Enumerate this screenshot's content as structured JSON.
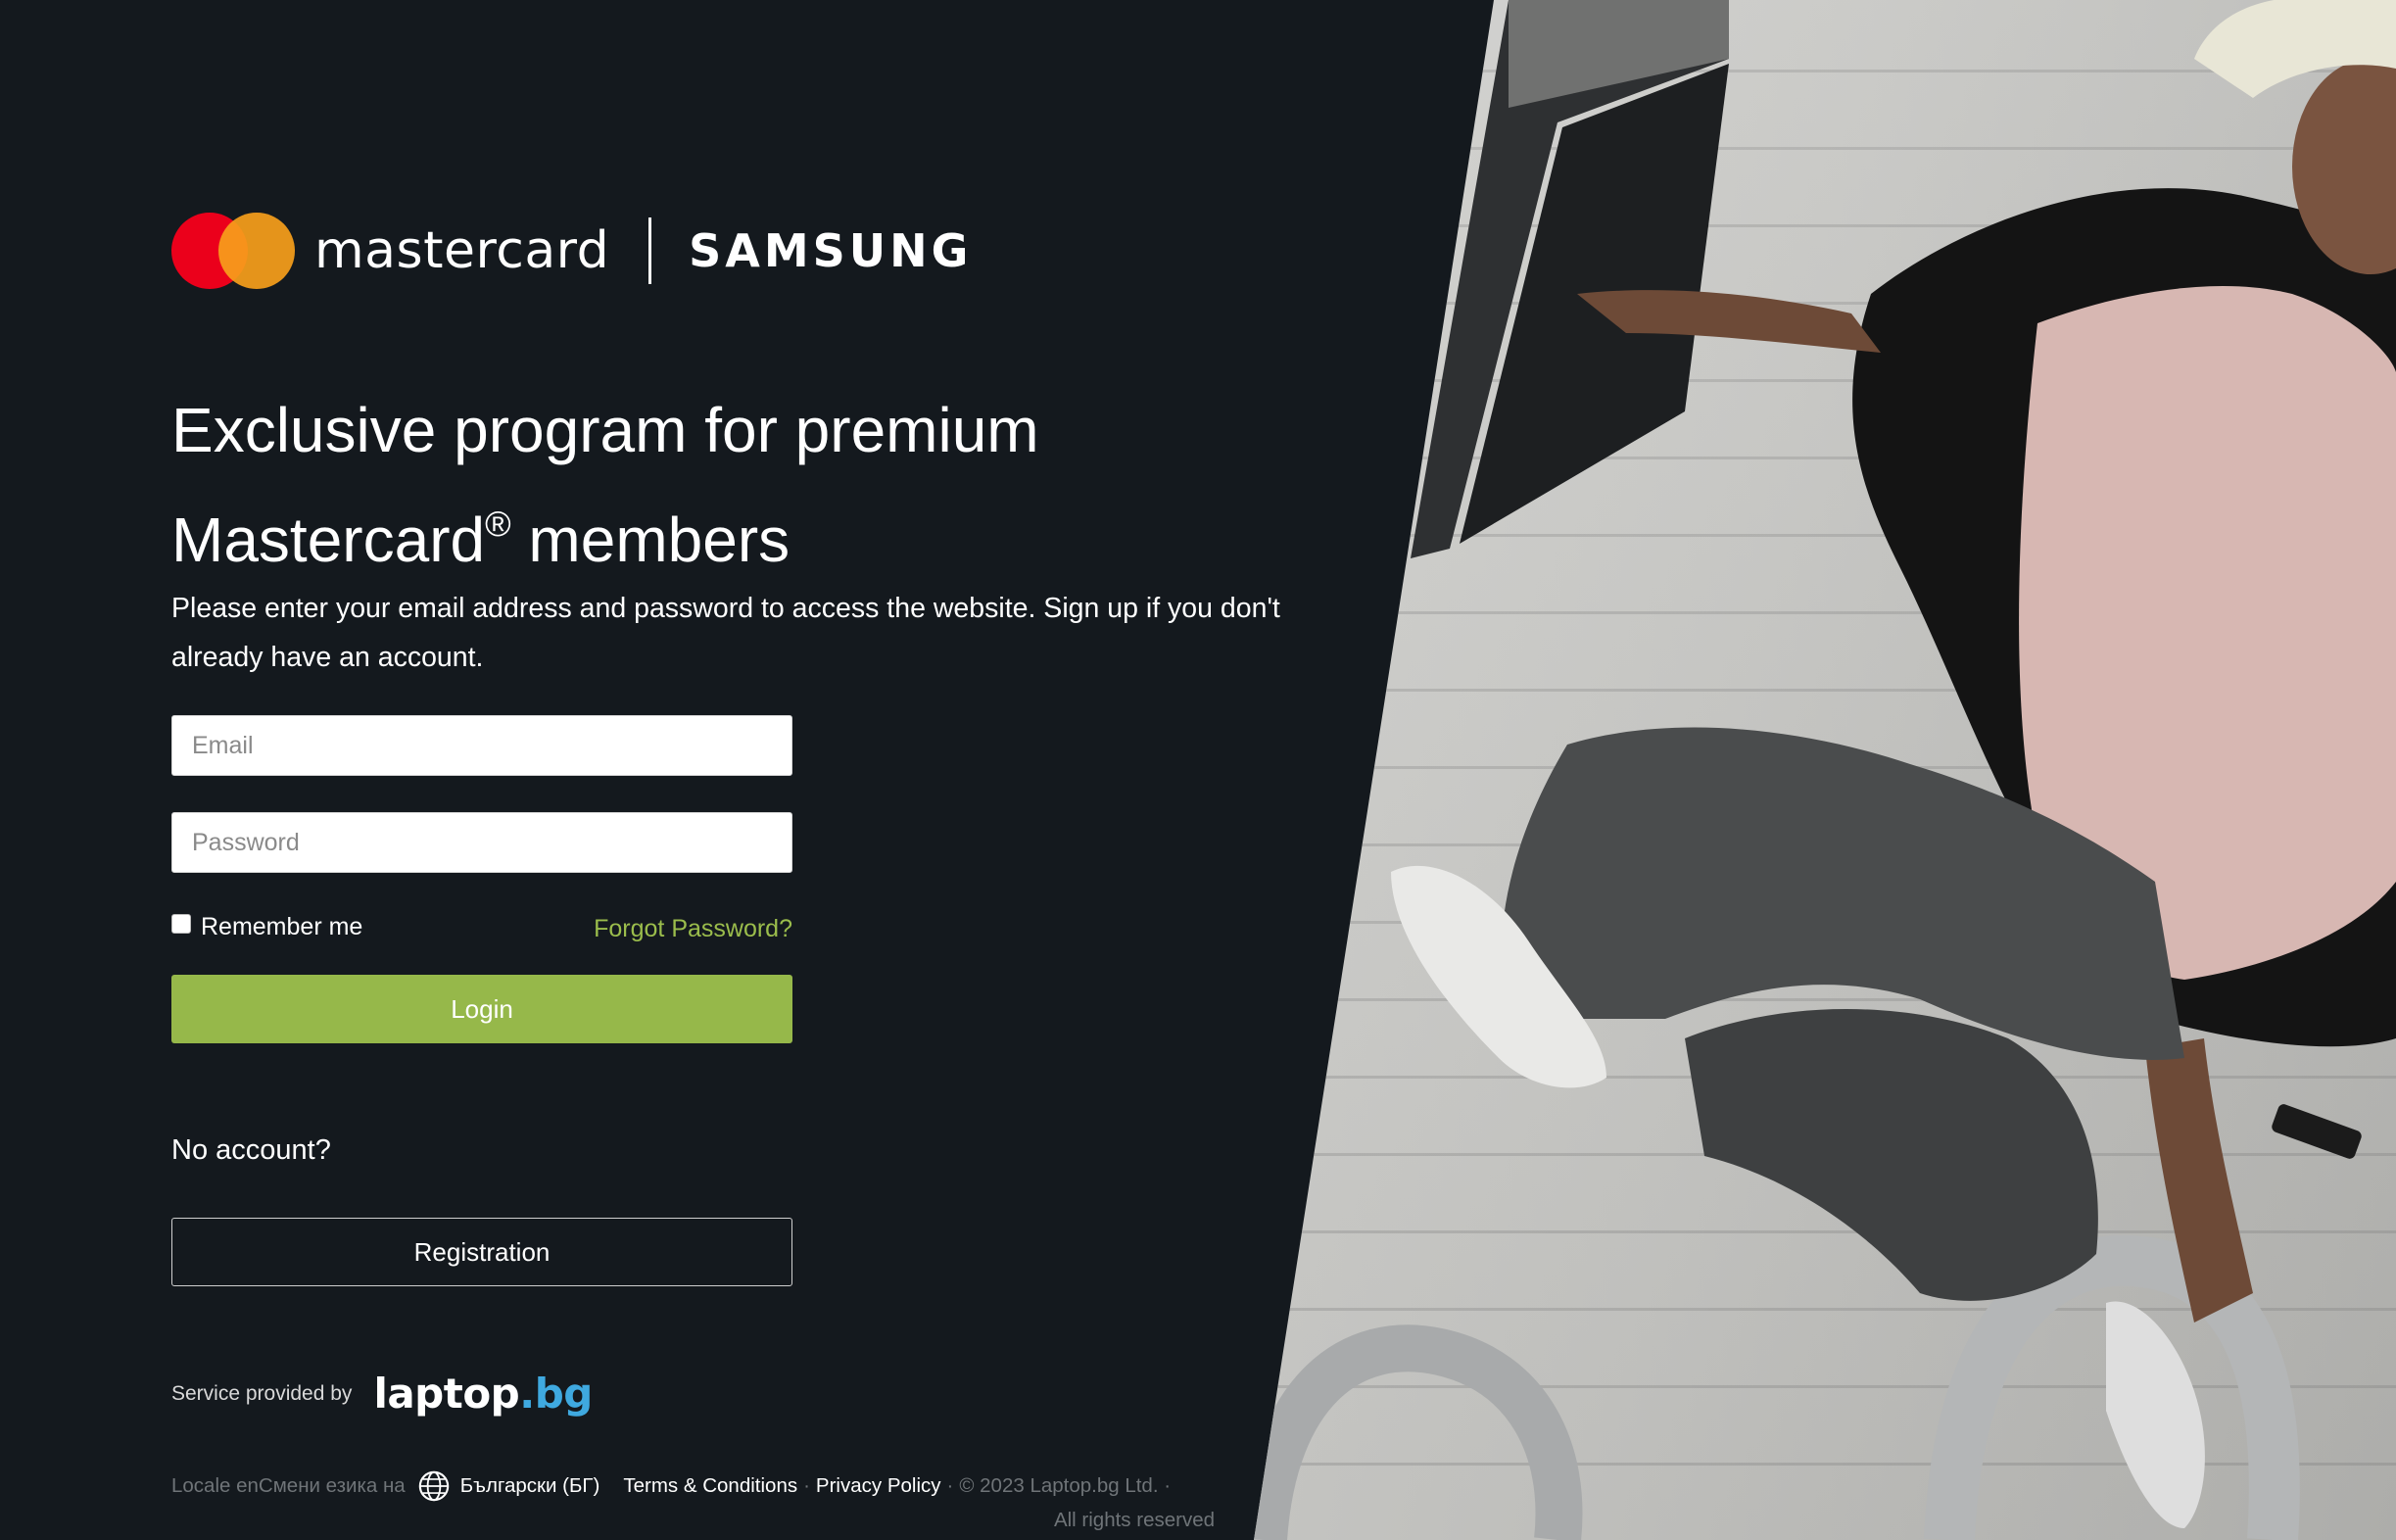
{
  "brand": {
    "mastercard_word": "mastercard",
    "samsung_word": "SAMSUNG",
    "colors": {
      "mc_red": "#eb001b",
      "mc_orange": "#f79e1b",
      "mc_overlap": "#ff5f00"
    }
  },
  "headline": {
    "line1": "Exclusive program for premium",
    "line2_pre": "Mastercard",
    "line2_sup": "®",
    "line2_post": " members"
  },
  "intro": "Please enter your email address and password to access the website. Sign up if you don't already have an account.",
  "form": {
    "email_placeholder": "Email",
    "email_value": "",
    "password_placeholder": "Password",
    "password_value": "",
    "remember_label": "Remember me",
    "remember_checked": false,
    "forgot_label": "Forgot Password?",
    "login_label": "Login",
    "accent_color": "#96b84a"
  },
  "signup": {
    "no_account": "No account?",
    "register_label": "Registration"
  },
  "service": {
    "text": "Service provided by",
    "logo_main": "laptop",
    "logo_suffix": ".bg"
  },
  "footer": {
    "locale_text": "Locale enСмени езика на",
    "language": "Български (БГ)",
    "terms": "Terms & Conditions",
    "privacy": "Privacy Policy",
    "copyright": "© 2023 Laptop.bg Ltd. ·",
    "rights": "All rights reserved",
    "separator": "·"
  },
  "photo": {
    "icon": "hero-photo-jumping-man"
  }
}
